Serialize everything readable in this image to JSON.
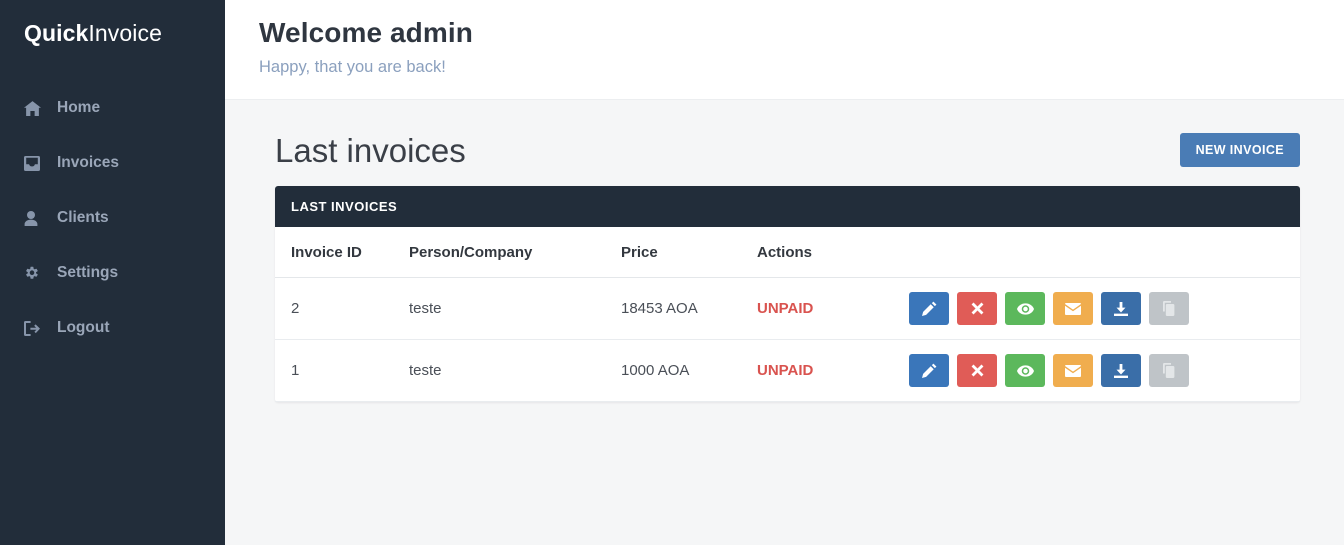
{
  "sidebar": {
    "brand_strong": "Quick",
    "brand_light": "Invoice",
    "items": [
      {
        "label": "Home",
        "icon": "home-icon"
      },
      {
        "label": "Invoices",
        "icon": "inbox-icon"
      },
      {
        "label": "Clients",
        "icon": "user-icon"
      },
      {
        "label": "Settings",
        "icon": "gear-icon"
      },
      {
        "label": "Logout",
        "icon": "sign-out-icon"
      }
    ],
    "bg_color": "#222d3a",
    "text_color": "#9aa6b8"
  },
  "topbar": {
    "title": "Welcome admin",
    "subtitle": "Happy, that you are back!"
  },
  "page": {
    "title": "Last invoices",
    "new_invoice_label": "NEW INVOICE",
    "new_invoice_color": "#4a7cb5"
  },
  "card": {
    "header": "LAST INVOICES",
    "header_color": "#222d3a",
    "columns": [
      "Invoice ID",
      "Person/Company",
      "Price",
      "Actions"
    ],
    "rows": [
      {
        "id": "2",
        "person": "teste",
        "price": "18453 AOA",
        "status": "UNPAID",
        "status_color": "#d9534f",
        "actions": [
          {
            "name": "edit-button",
            "icon": "pencil-icon",
            "color": "#3a76ba"
          },
          {
            "name": "delete-button",
            "icon": "times-icon",
            "color": "#e05c57"
          },
          {
            "name": "view-button",
            "icon": "eye-icon",
            "color": "#5cb85c"
          },
          {
            "name": "email-button",
            "icon": "envelope-icon",
            "color": "#f0ad4e"
          },
          {
            "name": "download-button",
            "icon": "download-icon",
            "color": "#3a6ea8"
          },
          {
            "name": "copy-button",
            "icon": "copy-icon",
            "color": "#bfc4c8"
          }
        ]
      },
      {
        "id": "1",
        "person": "teste",
        "price": "1000 AOA",
        "status": "UNPAID",
        "status_color": "#d9534f",
        "actions": [
          {
            "name": "edit-button",
            "icon": "pencil-icon",
            "color": "#3a76ba"
          },
          {
            "name": "delete-button",
            "icon": "times-icon",
            "color": "#e05c57"
          },
          {
            "name": "view-button",
            "icon": "eye-icon",
            "color": "#5cb85c"
          },
          {
            "name": "email-button",
            "icon": "envelope-icon",
            "color": "#f0ad4e"
          },
          {
            "name": "download-button",
            "icon": "download-icon",
            "color": "#3a6ea8"
          },
          {
            "name": "copy-button",
            "icon": "copy-icon",
            "color": "#bfc4c8"
          }
        ]
      }
    ]
  }
}
